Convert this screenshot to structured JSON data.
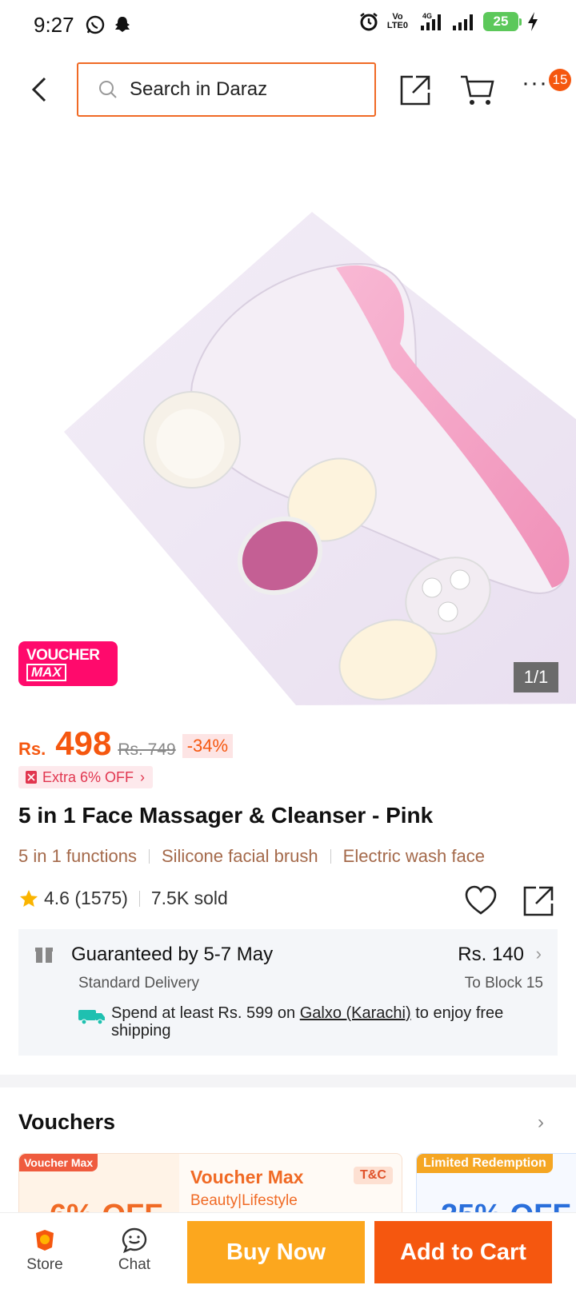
{
  "status_bar": {
    "time": "9:27",
    "network_label": "Vo LTE0",
    "network_type": "4G",
    "battery": "25"
  },
  "header": {
    "search_placeholder": "Search in Daraz",
    "cart_badge": "15"
  },
  "gallery": {
    "voucher_tag_line1": "VOUCHER",
    "voucher_tag_line2": "MAX",
    "counter": "1/1"
  },
  "price": {
    "currency": "Rs.",
    "current": "498",
    "original": "Rs. 749",
    "discount": "-34%",
    "extra_off": "Extra 6% OFF"
  },
  "product": {
    "title": "5 in 1 Face Massager & Cleanser - Pink",
    "features": [
      "5 in 1 functions",
      "Silicone facial brush",
      "Electric wash face"
    ],
    "rating": "4.6 (1575)",
    "sold": "7.5K sold"
  },
  "delivery": {
    "guarantee": "Guaranteed by 5-7 May",
    "fee": "Rs. 140",
    "type": "Standard Delivery",
    "destination": "To Block 15",
    "free_ship_prefix": "Spend at least Rs. 599 on ",
    "free_ship_store": "Galxo (Karachi)",
    "free_ship_suffix": " to enjoy free shipping"
  },
  "vouchers": {
    "title": "Vouchers",
    "cards": [
      {
        "tag": "Voucher Max",
        "value": "6% OFF",
        "name": "Voucher Max",
        "category": "Beauty|Lifestyle",
        "tc": "T&C"
      },
      {
        "tag": "Limited Redemption",
        "value": "25% OFF"
      }
    ]
  },
  "bottom_bar": {
    "store": "Store",
    "chat": "Chat",
    "buy_now": "Buy Now",
    "add_to_cart": "Add to Cart"
  },
  "colors": {
    "accent": "#f5570f",
    "buy_now": "#fca71e",
    "search_border": "#f06a25",
    "voucher_pink": "#ff0a6c"
  }
}
